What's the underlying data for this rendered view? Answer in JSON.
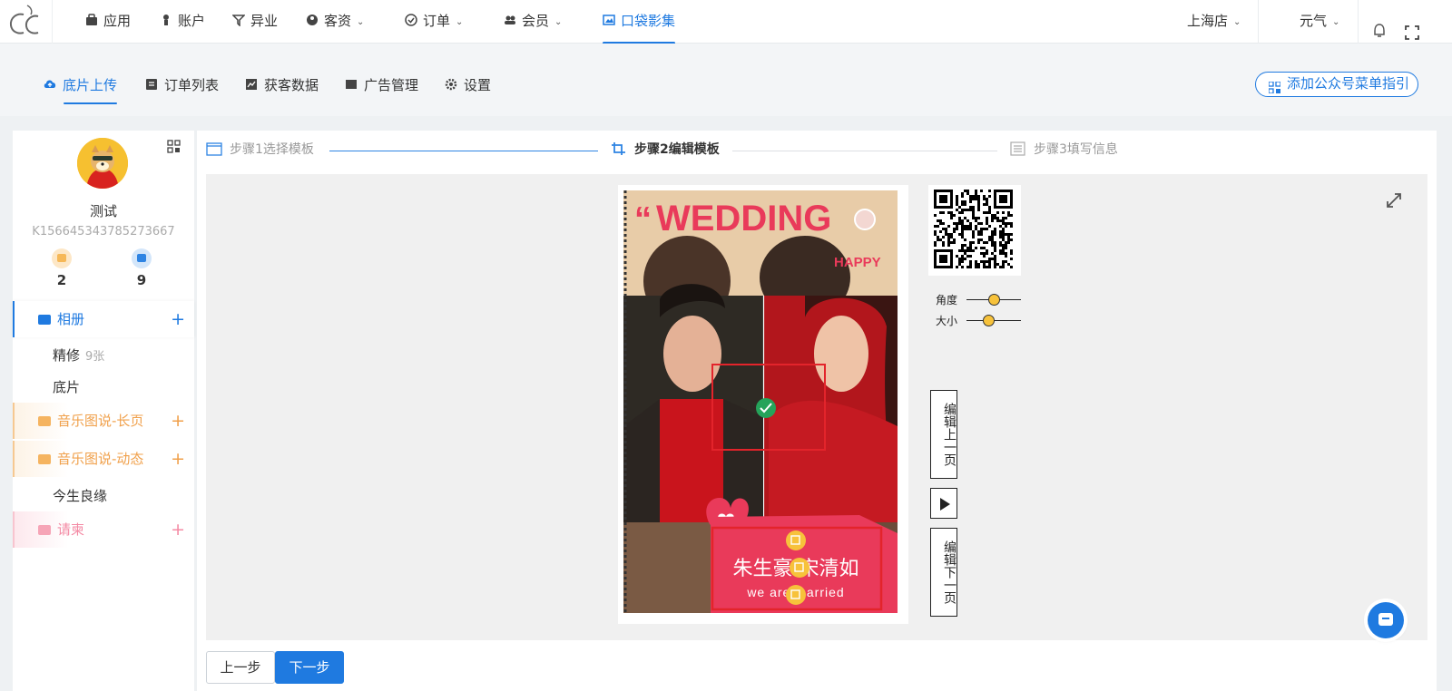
{
  "topnav": {
    "items": [
      {
        "label": "应用",
        "icon": "bag-icon"
      },
      {
        "label": "账户",
        "icon": "person-icon"
      },
      {
        "label": "异业",
        "icon": "filter-icon"
      },
      {
        "label": "客资",
        "icon": "people-icon"
      },
      {
        "label": "订单",
        "icon": "check-circle-icon"
      },
      {
        "label": "会员",
        "icon": "group-icon"
      },
      {
        "label": "口袋影集",
        "icon": "album-icon"
      }
    ],
    "store": "上海店",
    "user": "元气"
  },
  "subnav": {
    "items": [
      {
        "label": "底片上传",
        "icon": "cloud-upload-icon"
      },
      {
        "label": "订单列表",
        "icon": "list-icon"
      },
      {
        "label": "获客数据",
        "icon": "chart-icon"
      },
      {
        "label": "广告管理",
        "icon": "ad-icon"
      },
      {
        "label": "设置",
        "icon": "gear-icon"
      }
    ],
    "guide_button": "添加公众号菜单指引"
  },
  "sidebar": {
    "name": "测试",
    "id": "K156645343785273667",
    "stats": [
      "2",
      "9"
    ],
    "albums_label": "相册",
    "sub_albums": [
      {
        "label": "精修",
        "count": "9张"
      },
      {
        "label": "底片"
      }
    ],
    "music_long": "音乐图说-长页",
    "music_dynamic": "音乐图说-动态",
    "music_dynamic_child": "今生良缘",
    "invitation": "请柬"
  },
  "steps": [
    "步骤1选择模板",
    "步骤2编辑模板",
    "步骤3填写信息"
  ],
  "editor": {
    "poster_title": "WEDDING",
    "poster_happy": "HAPPY",
    "names": "朱生豪  宋清如",
    "subtitle": "we are married",
    "angle_label": "角度",
    "size_label": "大小",
    "angle_value": 0.5,
    "size_value": 0.4,
    "edit_prev": "编辑上一页",
    "edit_next": "编辑下一页"
  },
  "buttons": {
    "prev": "上一步",
    "next": "下一步"
  },
  "colors": {
    "accent": "#1f7ae0",
    "orange": "#f0a04b",
    "pink": "#f48aa4",
    "poster_red": "#e93a5a"
  }
}
